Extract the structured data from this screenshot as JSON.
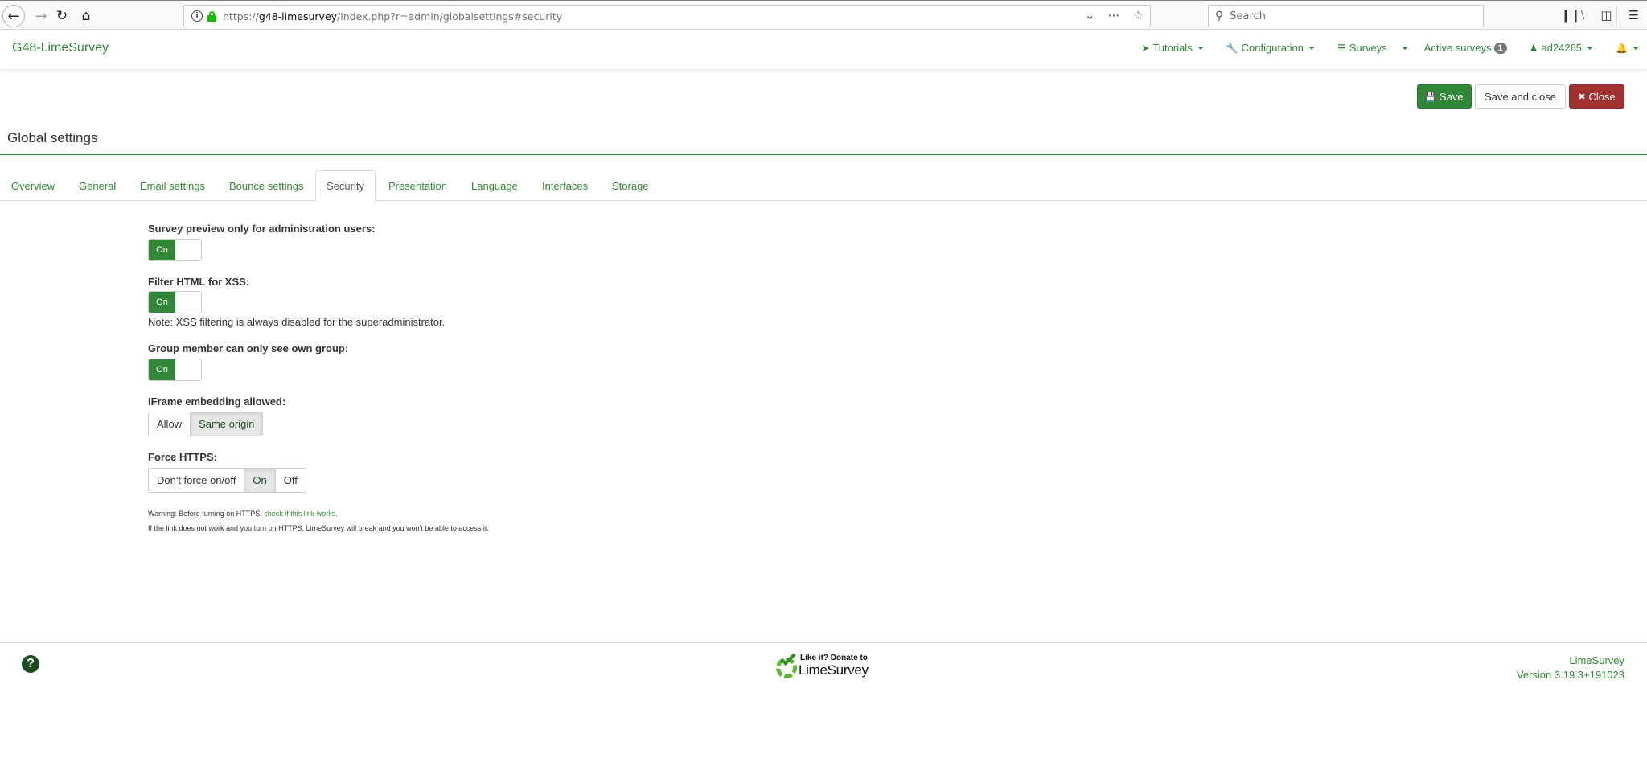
{
  "browser": {
    "url_prefix": "https://",
    "url_host": "g48-limesurvey",
    "url_path": "/index.php?r=admin/globalsettings#security",
    "search_placeholder": "Search"
  },
  "navbar": {
    "brand": "G48-LimeSurvey",
    "items": [
      {
        "label": "Tutorials",
        "icon": "rocket-icon"
      },
      {
        "label": "Configuration",
        "icon": "wrench-icon"
      },
      {
        "label": "Surveys",
        "icon": "list-icon"
      },
      {
        "label": "Active surveys",
        "badge": "1"
      },
      {
        "label": "ad24265",
        "icon": "user-icon"
      },
      {
        "label": "",
        "icon": "bell-icon"
      }
    ]
  },
  "actions": {
    "save": "Save",
    "save_and_close": "Save and close",
    "close": "Close"
  },
  "page": {
    "title": "Global settings",
    "tabs": [
      {
        "label": "Overview",
        "active": false
      },
      {
        "label": "General",
        "active": false
      },
      {
        "label": "Email settings",
        "active": false
      },
      {
        "label": "Bounce settings",
        "active": false
      },
      {
        "label": "Security",
        "active": true
      },
      {
        "label": "Presentation",
        "active": false
      },
      {
        "label": "Language",
        "active": false
      },
      {
        "label": "Interfaces",
        "active": false
      },
      {
        "label": "Storage",
        "active": false
      }
    ]
  },
  "form": {
    "survey_preview": {
      "label": "Survey preview only for administration users:",
      "value": "On"
    },
    "filter_xss": {
      "label": "Filter HTML for XSS:",
      "value": "On",
      "note": "Note: XSS filtering is always disabled for the superadministrator."
    },
    "group_member": {
      "label": "Group member can only see own group:",
      "value": "On"
    },
    "iframe": {
      "label": "IFrame embedding allowed:",
      "options": [
        "Allow",
        "Same origin"
      ],
      "selected": "Same origin"
    },
    "force_https": {
      "label": "Force HTTPS:",
      "options": [
        "Don't force on/off",
        "On",
        "Off"
      ],
      "selected": "On",
      "warning_prefix": "Warning: Before turning on HTTPS, ",
      "warning_link": "check if this link works.",
      "warning_text": "If the link does not work and you turn on HTTPS, LimeSurvey will break and you won't be able to access it."
    }
  },
  "footer": {
    "donate_line1": "Like it? Donate to",
    "donate_line2": "LimeSurvey",
    "product": "LimeSurvey",
    "version": "Version 3.19.3+191023"
  },
  "colors": {
    "brand_green": "#328637",
    "close_red": "#a2312f"
  }
}
